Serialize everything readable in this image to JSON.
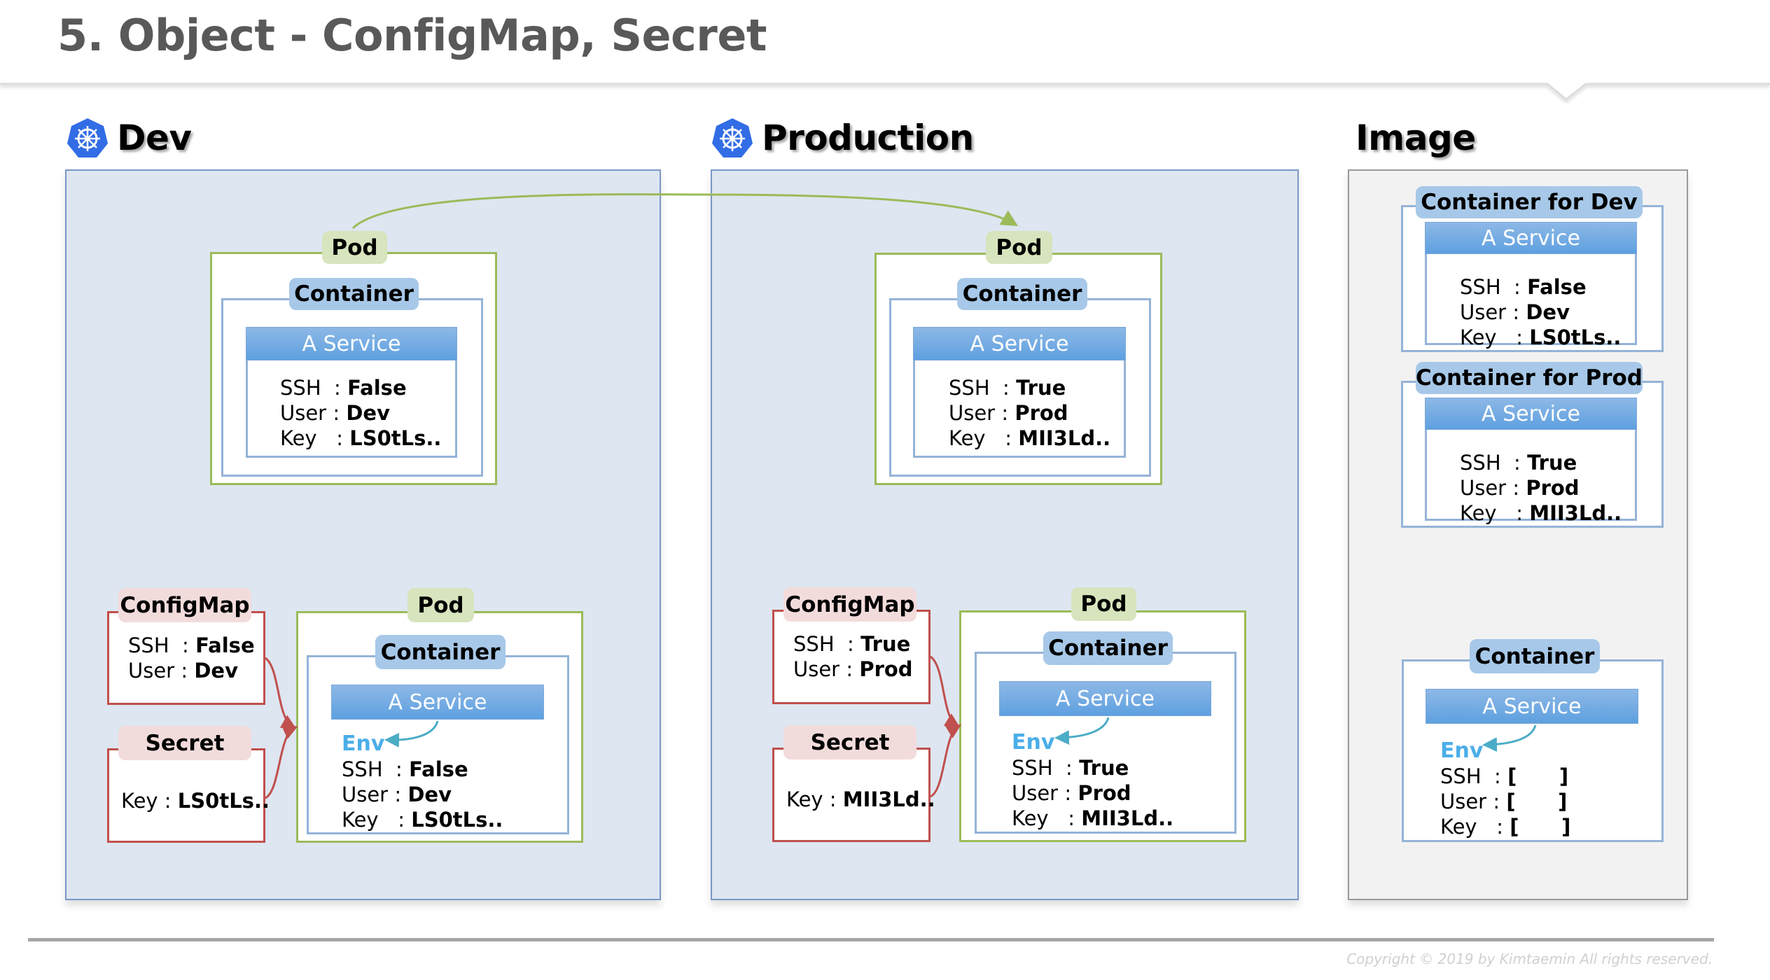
{
  "page": {
    "title": "5. Object - ConfigMap, Secret",
    "copyright": "Copyright © 2019 by Kimtaemin All rights reserved."
  },
  "colors": {
    "pod_border": "#9bbb59",
    "pod_label": "#d7e4bd",
    "container_border": "#95b3d7",
    "container_label": "#a7c8e8",
    "service_header": "#5ea0e0",
    "configmap_border": "#c0504d",
    "configmap_label": "#f2dcdb",
    "env_text": "#4baee8",
    "env_panel_bg": "#dee6f1",
    "image_panel_bg": "#f2f2f2"
  },
  "sections": {
    "dev": {
      "heading": "Dev",
      "icon": "kubernetes-icon",
      "top_pod": {
        "pod_label": "Pod",
        "container_label": "Container",
        "service_label": "A Service",
        "fields": [
          {
            "key": "SSH",
            "sep": "  : ",
            "value": "False"
          },
          {
            "key": "User",
            "sep": " : ",
            "value": "Dev"
          },
          {
            "key": "Key",
            "sep": "   : ",
            "value": "LS0tLs.."
          }
        ]
      },
      "configmap": {
        "label": "ConfigMap",
        "fields": [
          {
            "key": "SSH",
            "sep": "  : ",
            "value": "False"
          },
          {
            "key": "User",
            "sep": " : ",
            "value": "Dev"
          }
        ]
      },
      "secret": {
        "label": "Secret",
        "fields": [
          {
            "key": "Key",
            "sep": " : ",
            "value": "LS0tLs.."
          }
        ]
      },
      "bottom_pod": {
        "pod_label": "Pod",
        "container_label": "Container",
        "service_label": "A Service",
        "env_label": "Env",
        "fields": [
          {
            "key": "SSH",
            "sep": "  : ",
            "value": "False"
          },
          {
            "key": "User",
            "sep": " : ",
            "value": "Dev"
          },
          {
            "key": "Key",
            "sep": "   : ",
            "value": "LS0tLs.."
          }
        ]
      }
    },
    "production": {
      "heading": "Production",
      "icon": "kubernetes-icon",
      "top_pod": {
        "pod_label": "Pod",
        "container_label": "Container",
        "service_label": "A Service",
        "fields": [
          {
            "key": "SSH",
            "sep": "  : ",
            "value": "True"
          },
          {
            "key": "User",
            "sep": " : ",
            "value": "Prod"
          },
          {
            "key": "Key",
            "sep": "   : ",
            "value": "MII3Ld.."
          }
        ]
      },
      "configmap": {
        "label": "ConfigMap",
        "fields": [
          {
            "key": "SSH",
            "sep": "  : ",
            "value": "True"
          },
          {
            "key": "User",
            "sep": " : ",
            "value": "Prod"
          }
        ]
      },
      "secret": {
        "label": "Secret",
        "fields": [
          {
            "key": "Key",
            "sep": " : ",
            "value": "MII3Ld.."
          }
        ]
      },
      "bottom_pod": {
        "pod_label": "Pod",
        "container_label": "Container",
        "service_label": "A Service",
        "env_label": "Env",
        "fields": [
          {
            "key": "SSH",
            "sep": "  : ",
            "value": "True"
          },
          {
            "key": "User",
            "sep": " : ",
            "value": "Prod"
          },
          {
            "key": "Key",
            "sep": "   : ",
            "value": "MII3Ld.."
          }
        ]
      }
    },
    "image": {
      "heading": "Image",
      "container_dev": {
        "label": "Container for Dev",
        "service_label": "A Service",
        "fields": [
          {
            "key": "SSH",
            "sep": "  : ",
            "value": "False"
          },
          {
            "key": "User",
            "sep": " : ",
            "value": "Dev"
          },
          {
            "key": "Key",
            "sep": "   : ",
            "value": "LS0tLs.."
          }
        ]
      },
      "container_prod": {
        "label": "Container for Prod",
        "service_label": "A Service",
        "fields": [
          {
            "key": "SSH",
            "sep": "  : ",
            "value": "True"
          },
          {
            "key": "User",
            "sep": " : ",
            "value": "Prod"
          },
          {
            "key": "Key",
            "sep": "   : ",
            "value": "MII3Ld.."
          }
        ]
      },
      "container_generic": {
        "label": "Container",
        "service_label": "A Service",
        "env_label": "Env",
        "fields": [
          {
            "key": "SSH",
            "sep": "  : ",
            "value": "[      ]"
          },
          {
            "key": "User",
            "sep": " : ",
            "value": "[      ]"
          },
          {
            "key": "Key",
            "sep": "   : ",
            "value": "[      ]"
          }
        ]
      }
    }
  }
}
